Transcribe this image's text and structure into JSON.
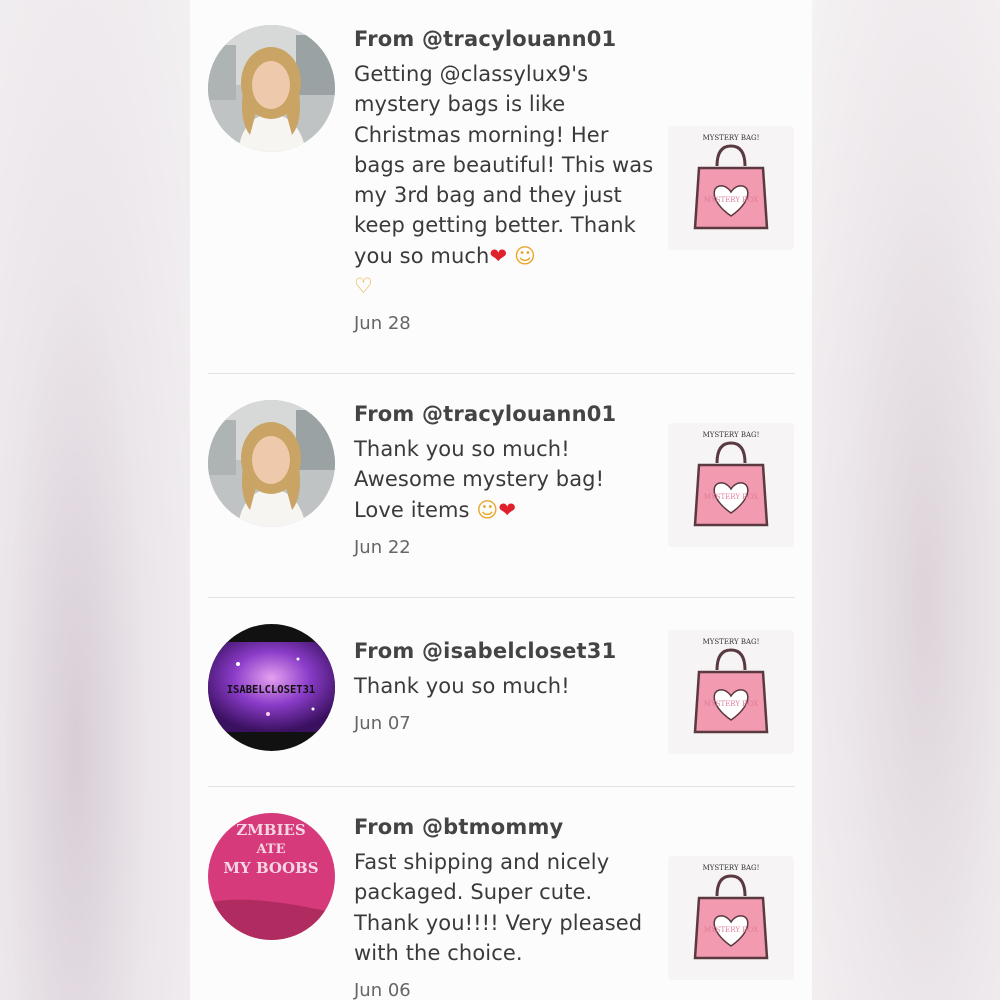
{
  "reviews": [
    {
      "from_prefix": "From ",
      "handle": "@tracylouann01",
      "message": "Getting @classylux9's mystery bags is like Christmas morning! Her bags are beautiful! This was my 3rd bag and they just keep getting better. Thank you so much",
      "emojis": [
        "red-heart",
        "heart-eyes-face",
        "heart-hands"
      ],
      "date": "Jun 28",
      "avatar": "woman-portrait",
      "thumbnail": {
        "title": "MYSTERY BAG!",
        "label": "MYSTERY BOX"
      }
    },
    {
      "from_prefix": "From ",
      "handle": "@tracylouann01",
      "message": "Thank you so much! Awesome mystery bag! Love items",
      "emojis": [
        "smiling-face-with-hearts",
        "red-heart"
      ],
      "date": "Jun 22",
      "avatar": "woman-portrait",
      "thumbnail": {
        "title": "MYSTERY BAG!",
        "label": "MYSTERY BOX"
      }
    },
    {
      "from_prefix": "From ",
      "handle": "@isabelcloset31",
      "message": "Thank you so much!",
      "emojis": [],
      "date": "Jun 07",
      "avatar": "isabelcloset-logo",
      "avatar_text": "ISABELCLOSET31",
      "thumbnail": {
        "title": "MYSTERY BAG!",
        "label": "MYSTERY BOX"
      }
    },
    {
      "from_prefix": "From ",
      "handle": "@btmommy",
      "message": "Fast shipping and nicely packaged. Super cute. Thank you!!!! Very pleased with the choice.",
      "emojis": [],
      "date": "Jun 06",
      "avatar": "pink-shirt",
      "avatar_text": "ZOMBIES ATE MY BOOBS",
      "thumbnail": {
        "title": "MYSTERY BAG!",
        "label": "MYSTERY BOX"
      }
    }
  ],
  "colors": {
    "bag_pink": "#f29ab0",
    "bag_outline": "#5a3a40",
    "heart": "#e0202a"
  }
}
